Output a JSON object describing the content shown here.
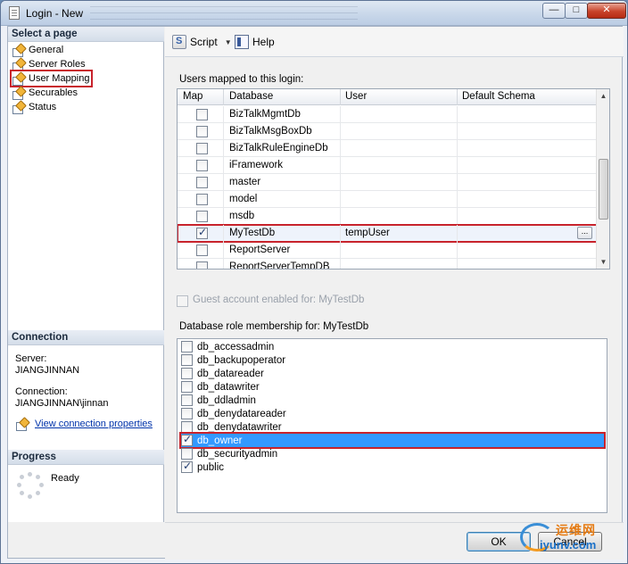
{
  "window": {
    "title": "Login - New"
  },
  "left": {
    "select_page_header": "Select a page",
    "pages": [
      {
        "label": "General"
      },
      {
        "label": "Server Roles"
      },
      {
        "label": "User Mapping"
      },
      {
        "label": "Securables"
      },
      {
        "label": "Status"
      }
    ],
    "connection_header": "Connection",
    "server_label": "Server:",
    "server_value": "JIANGJINNAN",
    "connection_label": "Connection:",
    "connection_value": "JIANGJINNAN\\jinnan",
    "view_link": "View connection properties",
    "progress_header": "Progress",
    "progress_status": "Ready"
  },
  "toolbar": {
    "script_label": "Script",
    "help_label": "Help"
  },
  "mapping": {
    "label": "Users mapped to this login:",
    "columns": [
      "Map",
      "Database",
      "User",
      "Default Schema"
    ],
    "rows": [
      {
        "database": "BizTalkMgmtDb",
        "user": "",
        "checked": false
      },
      {
        "database": "BizTalkMsgBoxDb",
        "user": "",
        "checked": false
      },
      {
        "database": "BizTalkRuleEngineDb",
        "user": "",
        "checked": false
      },
      {
        "database": "iFramework",
        "user": "",
        "checked": false
      },
      {
        "database": "master",
        "user": "",
        "checked": false
      },
      {
        "database": "model",
        "user": "",
        "checked": false
      },
      {
        "database": "msdb",
        "user": "",
        "checked": false
      },
      {
        "database": "MyTestDb",
        "user": "tempUser",
        "checked": true
      },
      {
        "database": "ReportServer",
        "user": "",
        "checked": false
      },
      {
        "database": "ReportServerTempDB",
        "user": "",
        "checked": false
      }
    ],
    "ellipsis": "..."
  },
  "guest": {
    "label": "Guest account enabled for: MyTestDb"
  },
  "roles": {
    "label": "Database role membership for: MyTestDb",
    "items": [
      {
        "name": "db_accessadmin",
        "checked": false
      },
      {
        "name": "db_backupoperator",
        "checked": false
      },
      {
        "name": "db_datareader",
        "checked": false
      },
      {
        "name": "db_datawriter",
        "checked": false
      },
      {
        "name": "db_ddladmin",
        "checked": false
      },
      {
        "name": "db_denydatareader",
        "checked": false
      },
      {
        "name": "db_denydatawriter",
        "checked": false
      },
      {
        "name": "db_owner",
        "checked": true
      },
      {
        "name": "db_securityadmin",
        "checked": false
      },
      {
        "name": "public",
        "checked": true
      }
    ]
  },
  "buttons": {
    "ok": "OK",
    "cancel": "Cancel"
  },
  "watermark": {
    "line1": "运维网",
    "line2": "iyunv.com"
  },
  "colors": {
    "highlight": "#3399ff",
    "annotation_red": "#c8232c",
    "link": "#0033aa"
  }
}
